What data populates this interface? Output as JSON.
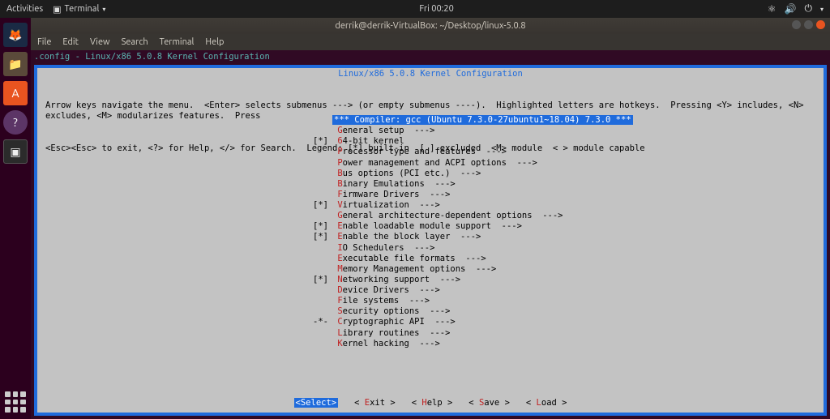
{
  "topbar": {
    "activities": "Activities",
    "terminal": "Terminal",
    "clock": "Fri 00:20"
  },
  "window": {
    "title": "derrik@derrik-VirtualBox: ~/Desktop/linux-5.0.8",
    "menus": [
      "File",
      "Edit",
      "View",
      "Search",
      "Terminal",
      "Help"
    ]
  },
  "config_title": ".config - Linux/x86 5.0.8 Kernel Configuration",
  "tui": {
    "header": "Linux/x86 5.0.8 Kernel Configuration",
    "help1": "Arrow keys navigate the menu.  <Enter> selects submenus ---> (or empty submenus ----).  Highlighted letters are hotkeys.  Pressing <Y> includes, <N> excludes, <M> modularizes features.  Press",
    "help2": "<Esc><Esc> to exit, <?> for Help, </> for Search.  Legend: [*] built-in  [ ] excluded  <M> module  < > module capable",
    "items": [
      {
        "prefix": "",
        "hot": "",
        "label": "*** Compiler: gcc (Ubuntu 7.3.0-27ubuntu1~18.04) 7.3.0 ***",
        "arrow": "",
        "selected": true
      },
      {
        "prefix": "   ",
        "hot": "G",
        "label": "eneral setup  --->",
        "arrow": ""
      },
      {
        "prefix": "[*]",
        "hot": "6",
        "label": "4-bit kernel",
        "arrow": ""
      },
      {
        "prefix": "   ",
        "hot": "P",
        "label": "rocessor type and features  --->",
        "arrow": ""
      },
      {
        "prefix": "   ",
        "hot": "P",
        "label": "ower management and ACPI options  --->",
        "arrow": ""
      },
      {
        "prefix": "   ",
        "hot": "B",
        "label": "us options (PCI etc.)  --->",
        "arrow": ""
      },
      {
        "prefix": "   ",
        "hot": "B",
        "label": "inary Emulations  --->",
        "arrow": ""
      },
      {
        "prefix": "   ",
        "hot": "F",
        "label": "irmware Drivers  --->",
        "arrow": ""
      },
      {
        "prefix": "[*]",
        "hot": "V",
        "label": "irtualization  --->",
        "arrow": ""
      },
      {
        "prefix": "   ",
        "hot": "G",
        "label": "eneral architecture-dependent options  --->",
        "arrow": ""
      },
      {
        "prefix": "[*]",
        "hot": "E",
        "label": "nable loadable module support  --->",
        "arrow": ""
      },
      {
        "prefix": "[*]",
        "hot": "E",
        "label": "nable the block layer  --->",
        "arrow": ""
      },
      {
        "prefix": "   ",
        "hot": "I",
        "label": "O Schedulers  --->",
        "arrow": ""
      },
      {
        "prefix": "   ",
        "hot": "E",
        "label": "xecutable file formats  --->",
        "arrow": ""
      },
      {
        "prefix": "   ",
        "hot": "M",
        "label": "emory Management options  --->",
        "arrow": ""
      },
      {
        "prefix": "[*]",
        "hot": "N",
        "label": "etworking support  --->",
        "arrow": ""
      },
      {
        "prefix": "   ",
        "hot": "D",
        "label": "evice Drivers  --->",
        "arrow": ""
      },
      {
        "prefix": "   ",
        "hot": "F",
        "label": "ile systems  --->",
        "arrow": ""
      },
      {
        "prefix": "   ",
        "hot": "S",
        "label": "ecurity options  --->",
        "arrow": ""
      },
      {
        "prefix": "-*-",
        "hot": "C",
        "label": "ryptographic API  --->",
        "arrow": ""
      },
      {
        "prefix": "   ",
        "hot": "L",
        "label": "ibrary routines  --->",
        "arrow": ""
      },
      {
        "prefix": "   ",
        "hot": "K",
        "label": "ernel hacking  --->",
        "arrow": ""
      }
    ],
    "buttons": [
      {
        "hot": "S",
        "label": "elect",
        "selected": true,
        "pre": "<",
        "post": ">"
      },
      {
        "hot": "E",
        "label": "xit",
        "selected": false,
        "pre": "< ",
        "post": " >"
      },
      {
        "hot": "H",
        "label": "elp",
        "selected": false,
        "pre": "< ",
        "post": " >"
      },
      {
        "hot": "S",
        "label": "ave",
        "selected": false,
        "pre": "< ",
        "post": " >"
      },
      {
        "hot": "L",
        "label": "oad",
        "selected": false,
        "pre": "< ",
        "post": " >"
      }
    ]
  }
}
